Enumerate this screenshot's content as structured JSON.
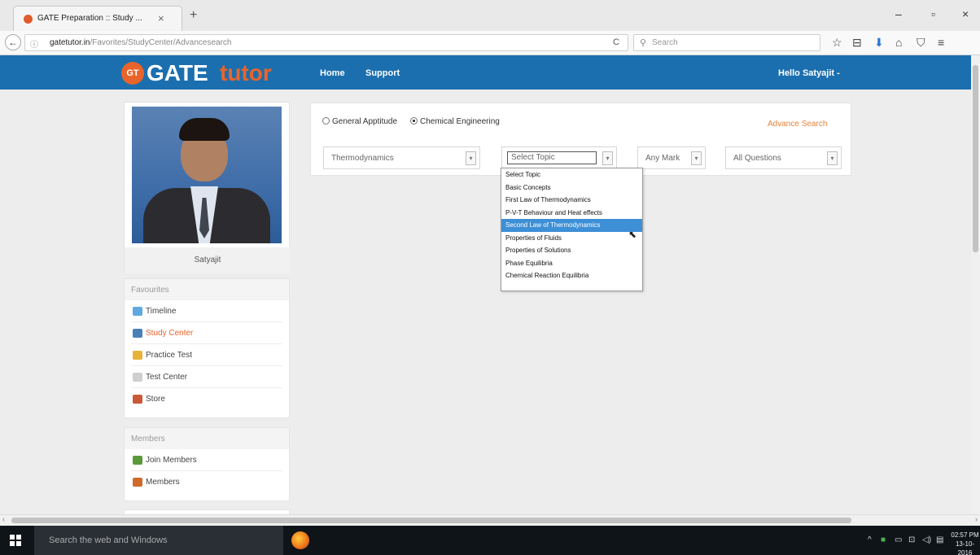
{
  "browser": {
    "tab_title": "GATE Preparation :: Study ...",
    "tab_close": "×",
    "new_tab": "+",
    "url_host": "gatetutor.in",
    "url_path": "/Favorites/StudyCenter/Advancesearch",
    "search_placeholder": "Search",
    "back_glyph": "←",
    "info_glyph": "ⓘ",
    "reload_glyph": "C",
    "search_glyph": "⚲",
    "win_min": "–",
    "win_max": "▫",
    "win_close": "×",
    "toolbar_icons": [
      "☆",
      "⊟",
      "⬇",
      "⌂",
      "⛉",
      "≡"
    ]
  },
  "site": {
    "logo_badge": "GT",
    "logo_gate": "GATE",
    "logo_tutor": "tutor",
    "nav": [
      "Home",
      "Support"
    ],
    "greeting": "Hello Satyajit -",
    "header_color": "#1c6fae",
    "accent_color": "#e9642a"
  },
  "profile": {
    "name": "Satyajit"
  },
  "favourites": {
    "heading": "Favourites",
    "items": [
      {
        "label": "Timeline",
        "icon": "timeline-icon",
        "active": false
      },
      {
        "label": "Study Center",
        "icon": "study-center-icon",
        "active": true
      },
      {
        "label": "Practice Test",
        "icon": "practice-test-icon",
        "active": false
      },
      {
        "label": "Test Center",
        "icon": "test-center-icon",
        "active": false
      },
      {
        "label": "Store",
        "icon": "store-icon",
        "active": false
      }
    ]
  },
  "members": {
    "heading": "Members",
    "items": [
      {
        "label": "Join Members",
        "icon": "join-members-icon"
      },
      {
        "label": "Members",
        "icon": "members-icon"
      }
    ]
  },
  "search": {
    "radio_options": [
      {
        "label": "General Apptitude",
        "selected": false
      },
      {
        "label": "Chemical Engineering",
        "selected": true
      }
    ],
    "advance_search": "Advance Search",
    "subject_value": "Thermodynamics",
    "topic_value": "Select Topic",
    "mark_value": "Any Mark",
    "questions_value": "All Questions",
    "topic_options": [
      "Select Topic",
      "Basic Concepts",
      "First Law of Thermodynamics",
      "P-V-T Behaviour and Heat effects",
      "Second Law of Thermodynamics",
      "Properties of Fluids",
      "Properties of Solutions",
      "Phase Equilibria",
      "Chemical Reaction Equilibria"
    ],
    "highlighted_option": "Second Law of Thermodynamics"
  },
  "taskbar": {
    "search_text": "Search the web and Windows",
    "time": "02:57 PM",
    "date": "13-10-2016"
  }
}
